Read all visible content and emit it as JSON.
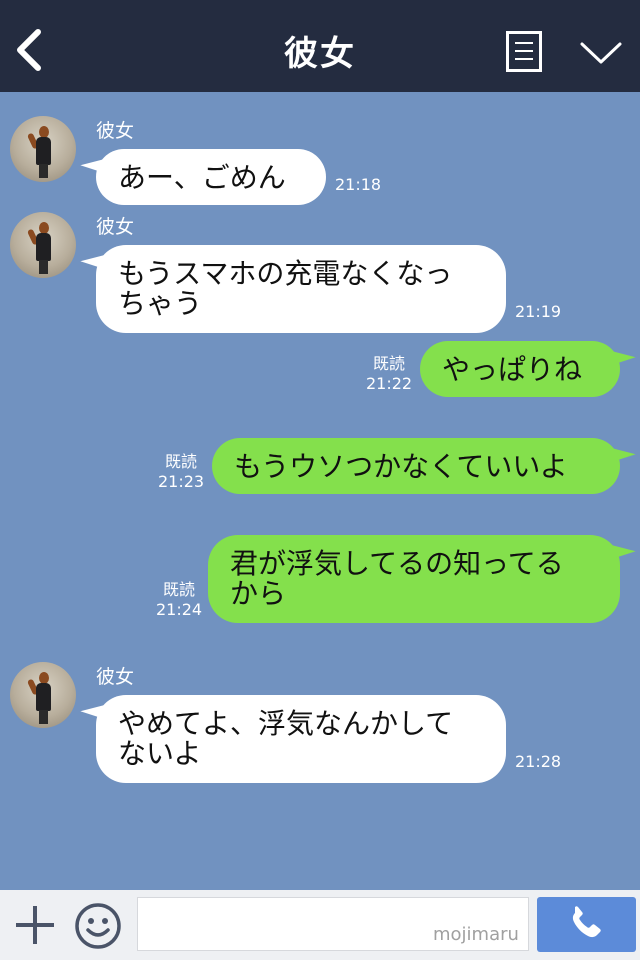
{
  "header": {
    "title": "彼女"
  },
  "messages": [
    {
      "sender": "彼女",
      "text": "あー、ごめん",
      "time": "21:18"
    },
    {
      "sender": "彼女",
      "text": "もうスマホの充電なくなっ\nちゃう",
      "time": "21:19"
    },
    {
      "read": "既読",
      "text": "やっぱりね",
      "time": "21:22"
    },
    {
      "read": "既読",
      "text": "もうウソつかなくていいよ",
      "time": "21:23"
    },
    {
      "read": "既読",
      "text": "君が浮気してるの知ってる\nから",
      "time": "21:24"
    },
    {
      "sender": "彼女",
      "text": "やめてよ、浮気なんかして\nないよ",
      "time": "21:28"
    }
  ],
  "footer": {
    "watermark": "mojimaru"
  },
  "colors": {
    "chat_background": "#7192c0",
    "header_background": "#242c40",
    "incoming_bubble": "#ffffff",
    "outgoing_bubble": "#84e04c",
    "call_button": "#5c8bd9"
  },
  "icons": [
    "back-chevron-icon",
    "menu-list-icon",
    "collapse-chevron-icon",
    "plus-icon",
    "emoji-icon",
    "phone-icon"
  ]
}
